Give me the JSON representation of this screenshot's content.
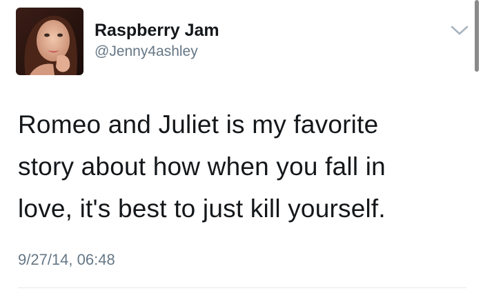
{
  "tweet": {
    "display_name": "Raspberry Jam",
    "handle": "@Jenny4ashley",
    "text_lines": [
      "Romeo and Juliet is my favorite",
      "story about how when you fall in",
      "love, it's best to just kill yourself."
    ],
    "timestamp": "9/27/14, 06:48"
  },
  "icons": {
    "menu": "chevron-down-icon"
  },
  "colors": {
    "primary_text": "#14171a",
    "secondary_text": "#657786",
    "divider": "#e1e8ed",
    "chevron": "#a8b4bf"
  }
}
